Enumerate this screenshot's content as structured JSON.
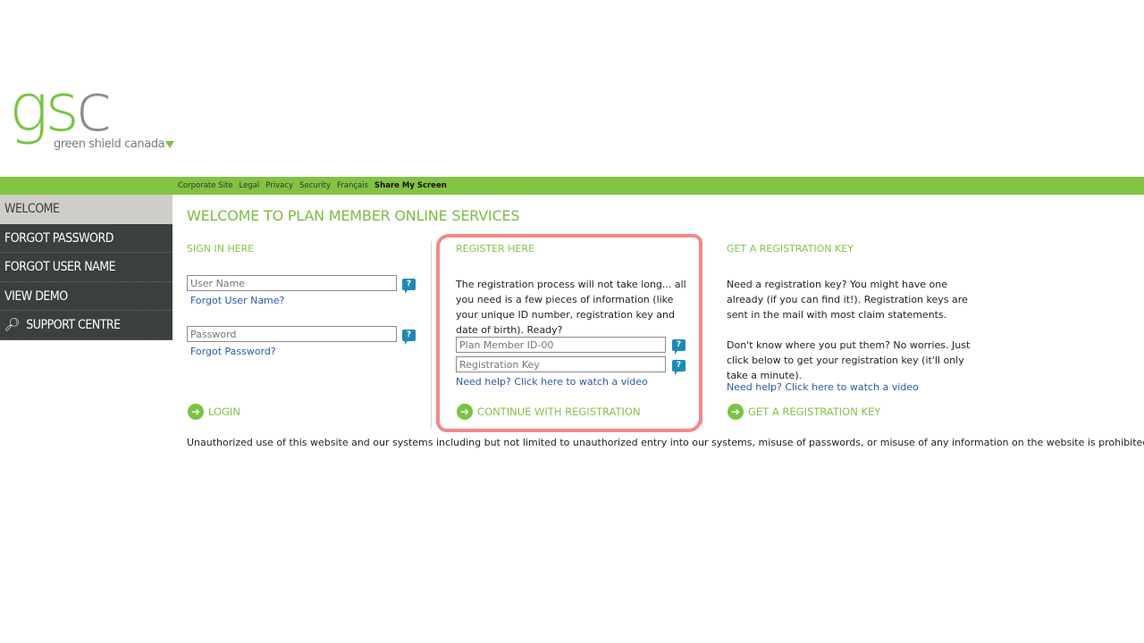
{
  "logo": {
    "letters": [
      "g",
      "s",
      "c"
    ],
    "tagline": "green shield canada",
    "alt": "gsc"
  },
  "topnav": {
    "items": [
      "Corporate Site",
      "Legal",
      "Privacy",
      "Security",
      "Français"
    ],
    "share": "Share My Screen"
  },
  "sidebar": {
    "items": [
      {
        "label": "WELCOME",
        "active": true
      },
      {
        "label": "FORGOT PASSWORD"
      },
      {
        "label": "FORGOT USER NAME"
      },
      {
        "label": "VIEW DEMO"
      },
      {
        "label": "SUPPORT CENTRE",
        "icon": "search-icon"
      }
    ]
  },
  "page_title": "WELCOME TO PLAN MEMBER ONLINE SERVICES",
  "signin": {
    "heading": "SIGN IN HERE",
    "username_placeholder": "User Name",
    "username_value": "",
    "forgot_username": "Forgot User Name?",
    "password_placeholder": "Password",
    "password_value": "",
    "forgot_password": "Forgot Password?",
    "login": "LOGIN",
    "help": "?"
  },
  "register": {
    "heading": "REGISTER HERE",
    "description": "The registration process will not take long... all you need is a few pieces of information (like your unique ID number, registration key and date of birth). Ready?",
    "member_id_placeholder": "Plan Member ID-00",
    "member_id_value": "",
    "reg_key_placeholder": "Registration Key",
    "reg_key_value": "",
    "video_link": "Need help? Click here to watch a video",
    "continue": "CONTINUE WITH REGISTRATION",
    "help": "?"
  },
  "regkey": {
    "heading": "GET A REGISTRATION KEY",
    "para1": "Need a registration key? You might have one already (if you can find it!). Registration keys are sent in the mail with most claim statements.",
    "para2": "Don't know where you put them? No worries. Just click below to get your registration key (it'll only take a minute).",
    "video_link": "Need help? Click here to watch a video",
    "action": "GET A REGISTRATION KEY"
  },
  "disclaimer": "Unauthorized use of this website and our systems including but not limited to unauthorized entry into our systems, misuse of passwords, or misuse of any information on the website is prohibited.",
  "colors": {
    "brand_green": "#82c341",
    "sidebar_dark": "#3b3f3e",
    "link_blue": "#2a5aa8",
    "help_blue": "#1e8ab6",
    "highlight": "#f17c7c"
  }
}
